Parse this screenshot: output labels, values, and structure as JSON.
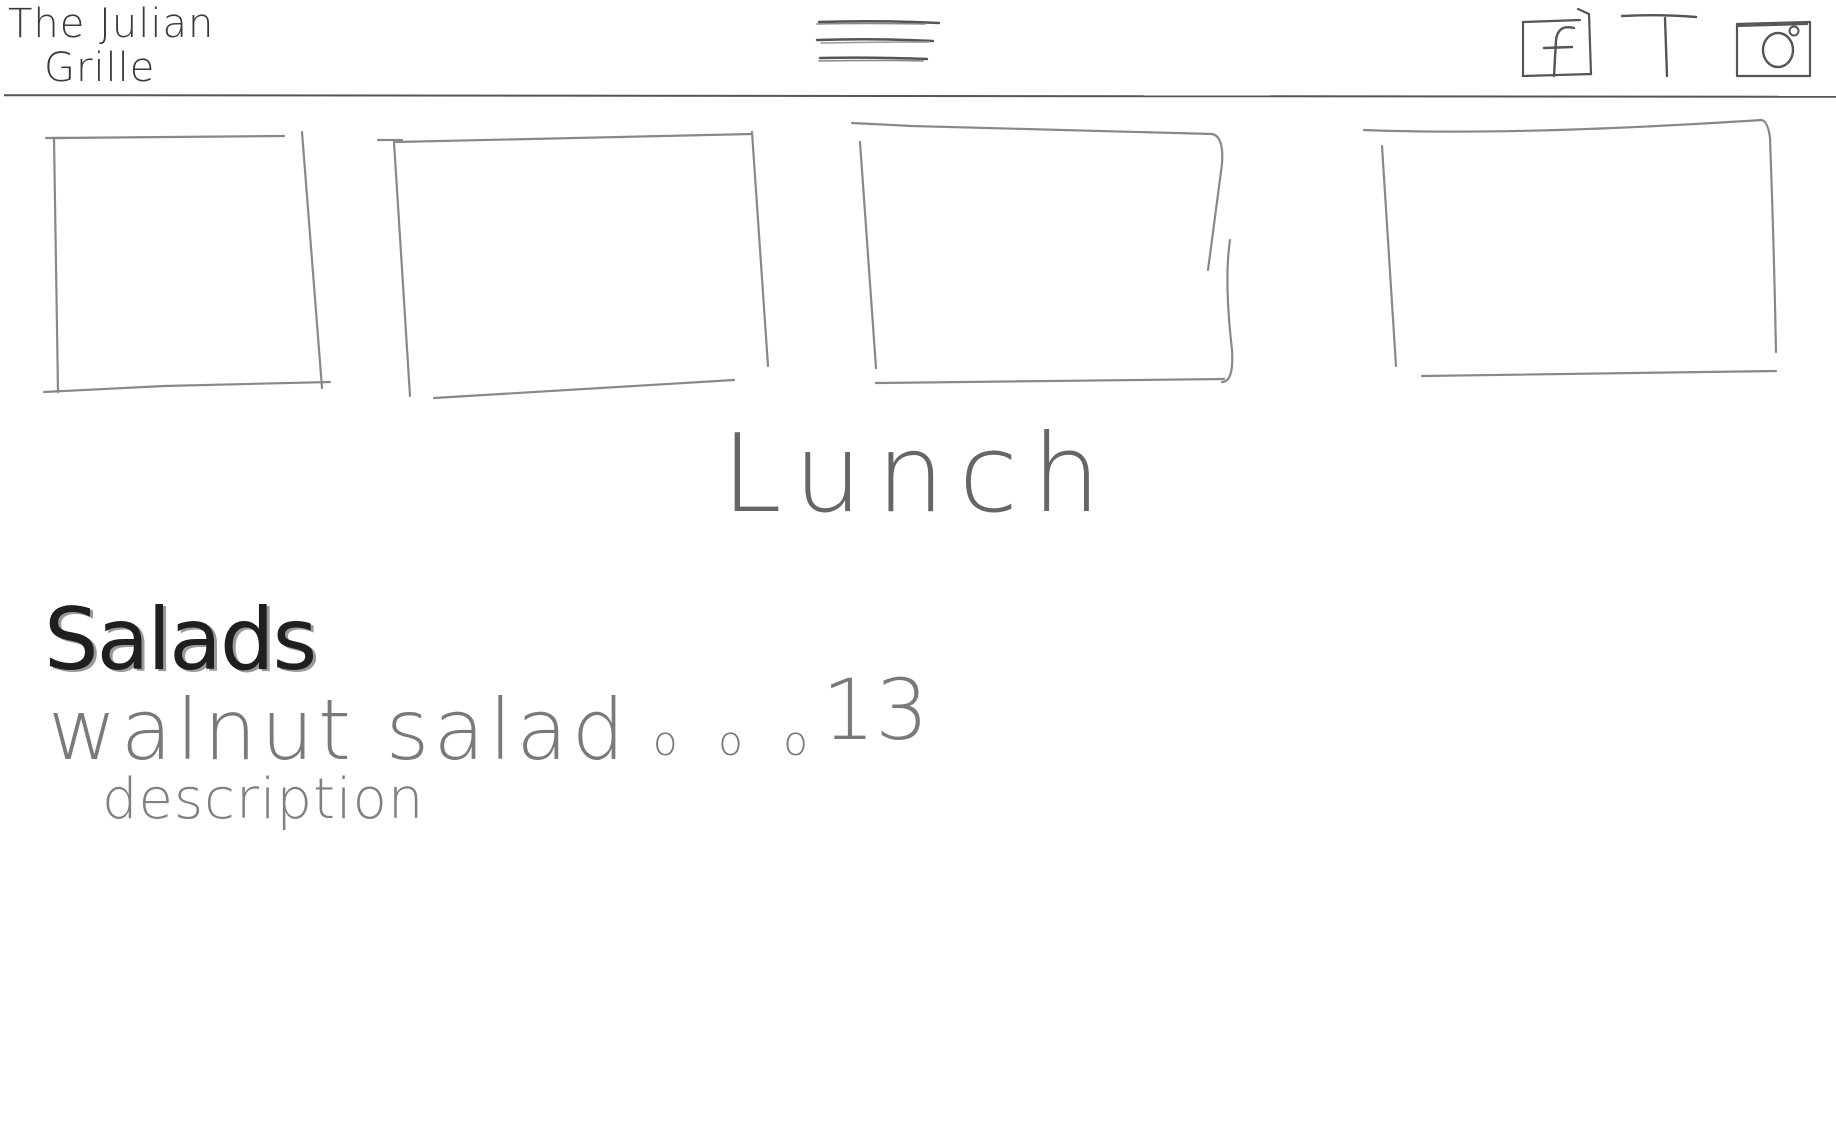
{
  "header": {
    "brand_line1": "The Julian",
    "brand_line2": "Grille",
    "menu_icon": "hamburger-menu-icon",
    "social": [
      {
        "name": "facebook",
        "icon": "facebook-icon"
      },
      {
        "name": "twitter",
        "icon": "twitter-icon"
      },
      {
        "name": "instagram",
        "icon": "instagram-icon"
      }
    ]
  },
  "gallery": {
    "tile_count": 4
  },
  "menu": {
    "section_title": "Lunch",
    "category": "Salads",
    "items": [
      {
        "name": "walnut salad",
        "leader": "o o o",
        "price": "13",
        "description": "description"
      }
    ]
  },
  "colors": {
    "ink": "#555555",
    "ink_dark": "#1f1f1f",
    "background": "#ffffff"
  }
}
